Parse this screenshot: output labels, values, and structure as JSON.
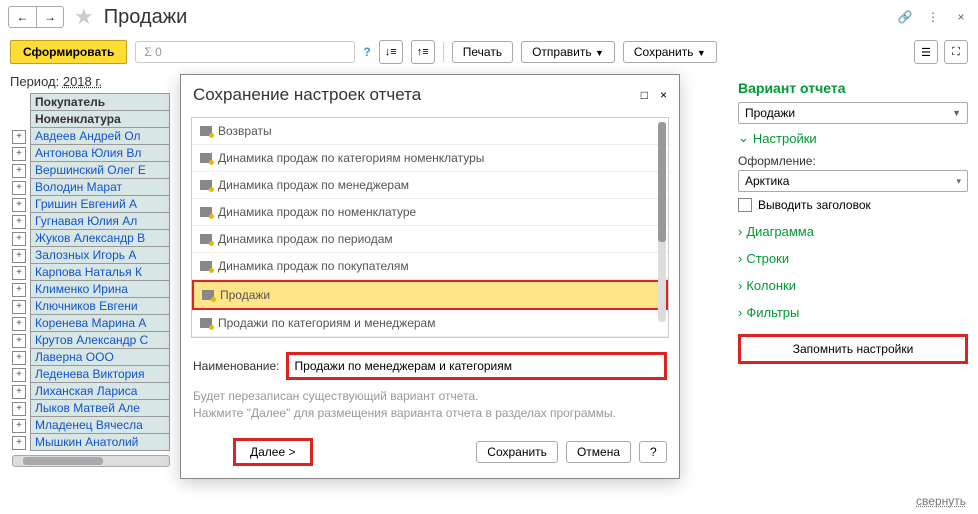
{
  "header": {
    "title": "Продажи"
  },
  "actions": {
    "generate": "Сформировать",
    "sum_placeholder": "Σ 0",
    "print": "Печать",
    "send": "Отправить",
    "save": "Сохранить"
  },
  "period": {
    "label": "Период:",
    "value": "2018 г."
  },
  "grid": {
    "headers": [
      "Покупатель",
      "Номенклатура"
    ],
    "rows": [
      "Авдеев Андрей Ол",
      "Антонова Юлия Вл",
      "Вершинский Олег Е",
      "Володин Марат",
      "Гришин Евгений А",
      "Гугнавая Юлия Ал",
      "Жуков Александр В",
      "Залозных Игорь А",
      "Карпова Наталья К",
      "Клименко Ирина",
      "Ключников Евгени",
      "Коренева Марина А",
      "Крутов Александр С",
      "Лаверна ООО",
      "Леденева Виктория",
      "Лиханская Лариса",
      "Лыков Матвей Але",
      "Младенец Вячесла",
      "Мышкин Анатолий"
    ]
  },
  "right": {
    "variant_title": "Вариант отчета",
    "variant_value": "Продажи",
    "settings": "Настройки",
    "design_label": "Оформление:",
    "design_value": "Арктика",
    "show_header": "Выводить заголовок",
    "diagram": "Диаграмма",
    "rows": "Строки",
    "cols": "Колонки",
    "filters": "Фильтры",
    "remember": "Запомнить настройки",
    "collapse": "свернуть"
  },
  "dialog": {
    "title": "Сохранение настроек отчета",
    "items": [
      "Возвраты",
      "Динамика продаж по категориям номенклатуры",
      "Динамика продаж по менеджерам",
      "Динамика продаж по номенклатуре",
      "Динамика продаж по периодам",
      "Динамика продаж по покупателям",
      "Продажи",
      "Продажи по категориям и менеджерам"
    ],
    "selected_index": 6,
    "name_label": "Наименование:",
    "name_value": "Продажи по менеджерам и категориям",
    "info": "Будет перезаписан существующий вариант отчета.\nНажмите \"Далее\" для размещения варианта отчета в разделах программы.",
    "next": "Далее  >",
    "save": "Сохранить",
    "cancel": "Отмена",
    "help": "?"
  }
}
